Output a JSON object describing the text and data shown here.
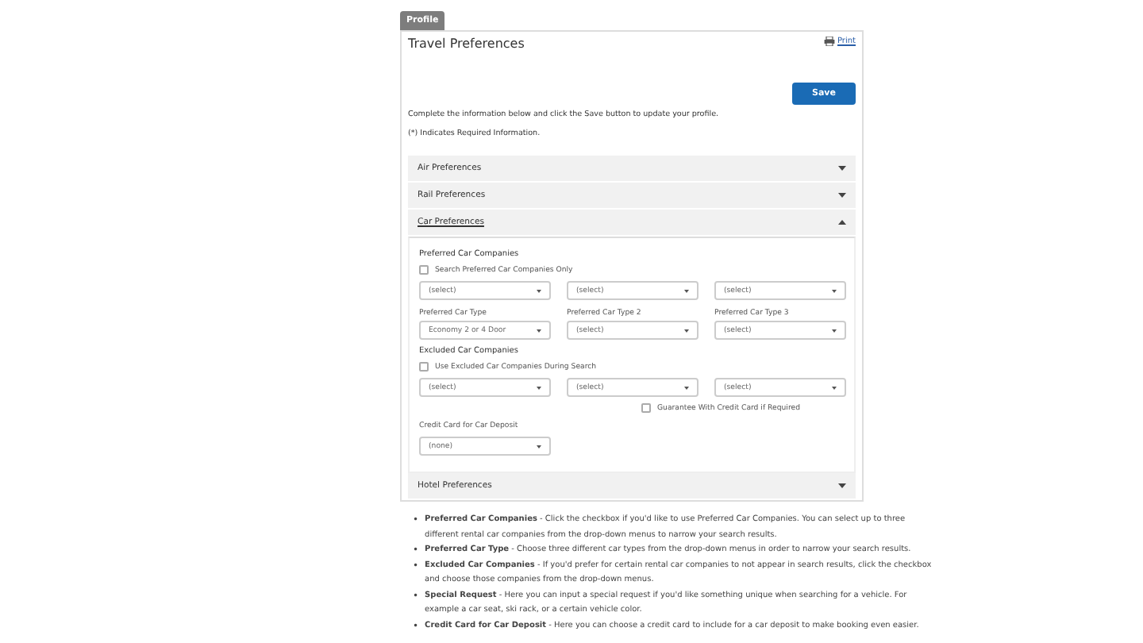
{
  "profile_tab": "Profile",
  "title": "Travel Preferences",
  "print_link": "Print",
  "save_button": "Save",
  "intro": [
    "Complete the information below and click the Save button to update your profile.",
    "(*) Indicates Required Information."
  ],
  "sections": [
    {
      "label": "Air Preferences",
      "expanded": false
    },
    {
      "label": "Rail Preferences",
      "expanded": false
    },
    {
      "label": "Car Preferences",
      "expanded": true
    },
    {
      "label": "Hotel Preferences",
      "expanded": false
    }
  ],
  "car_preferences": {
    "preferred_companies": {
      "heading": "Preferred Car Companies",
      "checkbox": {
        "label": "Search Preferred Car Companies Only",
        "checked": false
      },
      "selects": [
        "(select)",
        "(select)",
        "(select)"
      ]
    },
    "car_types": [
      {
        "label": "Preferred Car Type",
        "value": "Economy 2 or 4 Door"
      },
      {
        "label": "Preferred Car Type 2",
        "value": "(select)"
      },
      {
        "label": "Preferred Car Type 3",
        "value": "(select)"
      }
    ],
    "excluded_companies": {
      "heading": "Excluded Car Companies",
      "checkbox": {
        "label": "Use Excluded Car Companies During Search",
        "checked": false
      },
      "selects": [
        "(select)",
        "(select)",
        "(select)"
      ]
    },
    "guarantee": {
      "label": "Guarantee With Credit Card if Required",
      "checked": false
    },
    "deposit": {
      "label": "Credit Card for Car Deposit",
      "value": "(none)"
    }
  },
  "help_list": [
    {
      "bullet": "•",
      "text": "**Preferred Car Companies** - Click the checkbox if you'd like to use Preferred Car Companies. You can select up to three different rental car companies from the drop-down menus to narrow your search results."
    },
    {
      "bullet": "•",
      "text": "**Preferred Car Type** - Choose three different car types from the drop-down menus in order to narrow your search results."
    },
    {
      "bullet": "•",
      "text": "**Excluded Car Companies** - If you'd prefer for certain rental car companies to not appear in search results, click the checkbox and choose those companies from the drop-down menus."
    },
    {
      "bullet": "•",
      "text": "**Special Request** - Here you can input a special request if you'd like something unique when searching for a vehicle. For example a car seat, ski rack, or a certain vehicle color."
    },
    {
      "bullet": "•",
      "text": "**Credit Card for Car Deposit** - Here you can choose a credit card to include for a car deposit to make booking even easier."
    }
  ]
}
